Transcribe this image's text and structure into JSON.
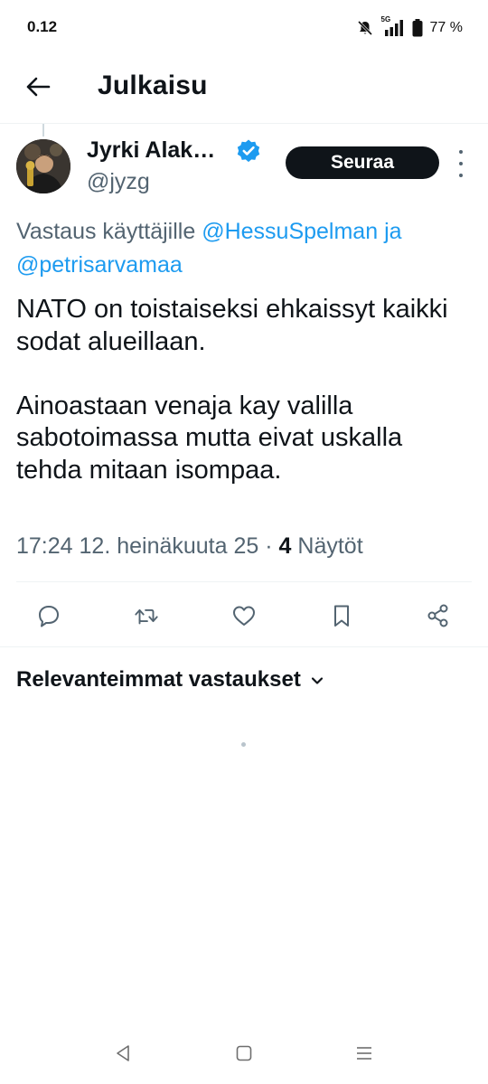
{
  "status_bar": {
    "time": "0.12",
    "network": "5G",
    "battery": "77 %"
  },
  "header": {
    "title": "Julkaisu"
  },
  "post": {
    "author_name": "Jyrki Alak…",
    "author_handle": "@jyzg",
    "follow_label": "Seuraa",
    "reply_prefix": "Vastaus käyttäjille",
    "mention_1": "@HessuSpelman",
    "conjunction": "ja",
    "mention_2": "@petrisarvamaa",
    "text_line_1": "NATO on toistaiseksi ehkaissyt kaikki sodat alueillaan.",
    "text_line_2": "Ainoastaan venaja kay valilla sabotoimassa mutta eivat uskalla tehda mitaan isompaa.",
    "timestamp": "17:24 12. heinäkuuta 25",
    "separator": "·",
    "views_count": "4",
    "views_label": "Näytöt"
  },
  "replies": {
    "sort_label": "Relevanteimmat vastaukset"
  },
  "icons": {
    "back": "arrow-left-icon",
    "verified": "verified-badge-icon",
    "more": "more-vertical-icon",
    "reply": "comment-icon",
    "repost": "repost-icon",
    "like": "heart-icon",
    "bookmark": "bookmark-icon",
    "share": "share-icon",
    "sort": "chevron-down-icon"
  },
  "colors": {
    "accent": "#1d9bf0",
    "text_primary": "#0f1419",
    "text_secondary": "#536471",
    "divider": "#eff3f4"
  }
}
